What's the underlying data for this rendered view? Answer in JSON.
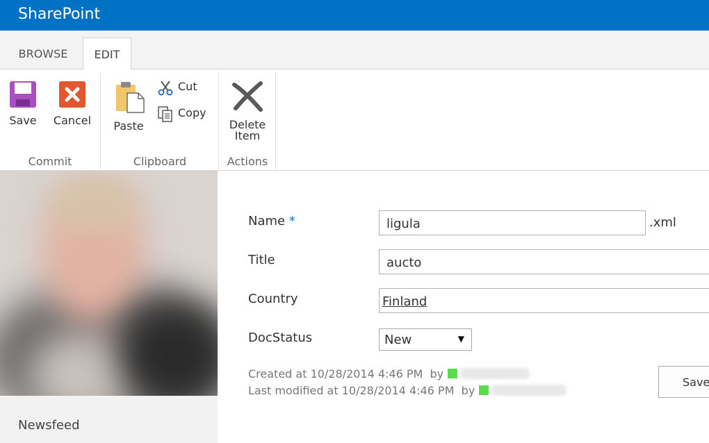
{
  "suitebar": {
    "brand": "SharePoint"
  },
  "ribbon": {
    "tabs": [
      {
        "label": "BROWSE"
      },
      {
        "label": "EDIT"
      }
    ],
    "groups": {
      "commit": {
        "label": "Commit",
        "save": "Save",
        "cancel": "Cancel"
      },
      "clipboard": {
        "label": "Clipboard",
        "paste": "Paste",
        "cut": "Cut",
        "copy": "Copy"
      },
      "actions": {
        "label": "Actions",
        "delete_line1": "Delete",
        "delete_line2": "Item"
      }
    }
  },
  "leftpane": {
    "newsfeed": "Newsfeed"
  },
  "form": {
    "name": {
      "label": "Name",
      "required": "*",
      "value": "ligula",
      "extension": ".xml"
    },
    "title": {
      "label": "Title",
      "value": "aucto"
    },
    "country": {
      "label": "Country",
      "value": "Finland"
    },
    "docstatus": {
      "label": "DocStatus",
      "value": "New"
    },
    "created": {
      "text": "Created at 10/28/2014 4:46 PM",
      "by": "by"
    },
    "modified": {
      "text": "Last modified at 10/28/2014 4:46 PM",
      "by": "by"
    },
    "save_button": "Save"
  },
  "colors": {
    "suitebar": "#0072c6",
    "presence": "#5ddc4b",
    "save_icon": "#a94fc2",
    "cancel_icon": "#e3572f"
  }
}
